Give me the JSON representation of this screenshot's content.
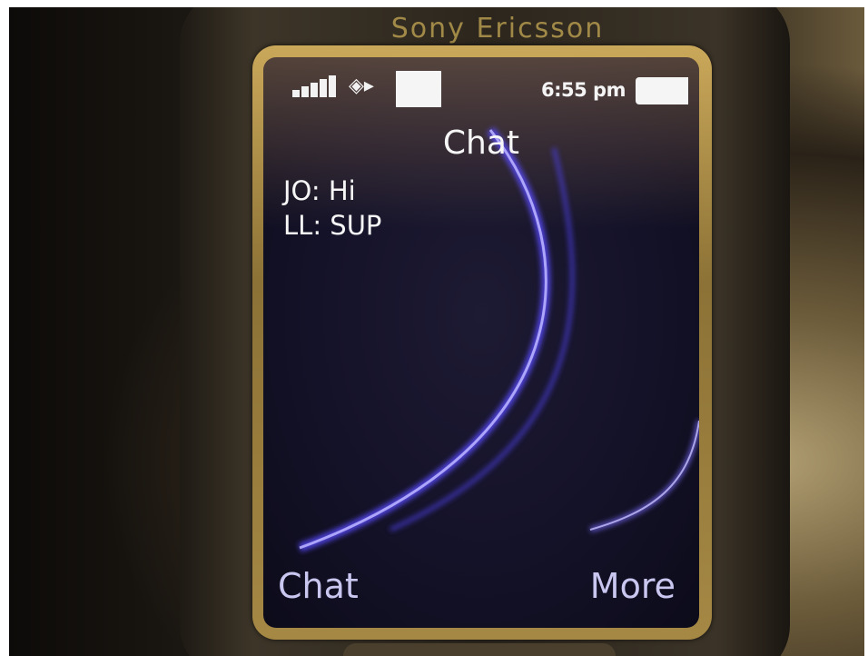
{
  "device": {
    "brand_text": "Sony Ericsson"
  },
  "status_bar": {
    "icons": [
      "signal-strength-icon",
      "data-transfer-icon",
      "white-square-icon",
      "battery-icon"
    ],
    "time": "6:55 pm"
  },
  "screen": {
    "title": "Chat",
    "messages": [
      {
        "text": "JO: Hi"
      },
      {
        "text": "LL: SUP"
      }
    ]
  },
  "softkeys": {
    "left_label": "Chat",
    "right_label": "More"
  },
  "colors": {
    "bezel_gold": "#caa85a",
    "screen_background": "#141228",
    "swirl_accent": "#6a5cff",
    "softkey_text": "#c9c6f0"
  }
}
